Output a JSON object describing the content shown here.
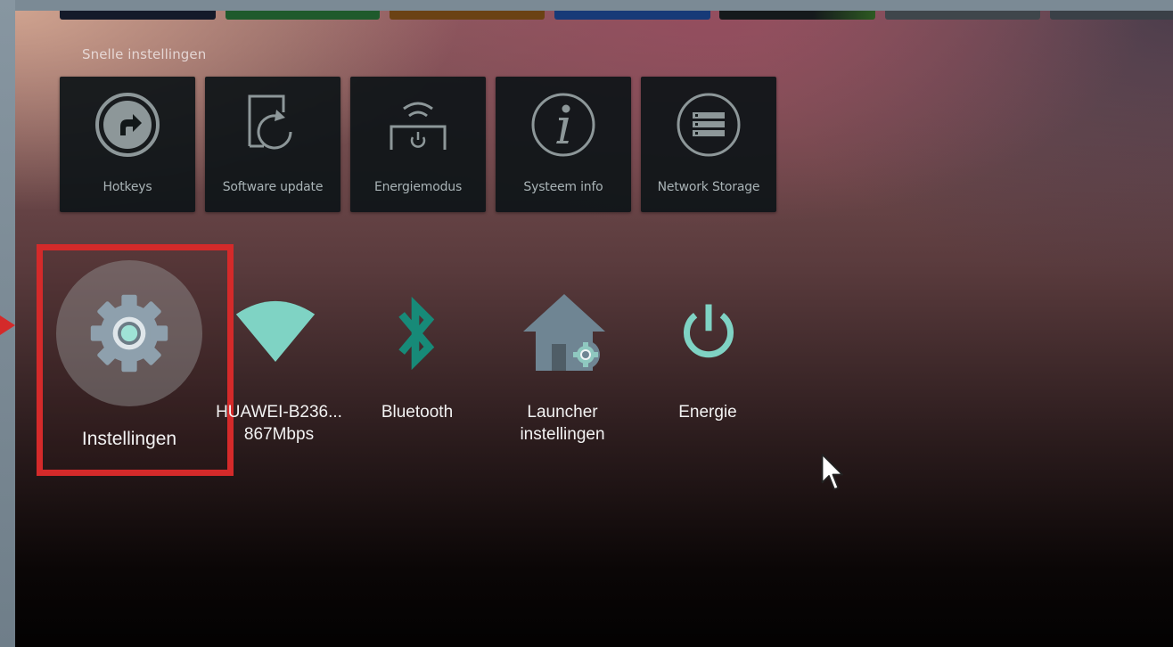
{
  "quick_settings": {
    "title": "Snelle instellingen",
    "tiles": [
      {
        "label": "Hotkeys",
        "icon": "hotkeys-icon"
      },
      {
        "label": "Software update",
        "icon": "software-update-icon"
      },
      {
        "label": "Energiemodus",
        "icon": "energy-mode-icon"
      },
      {
        "label": "Systeem info",
        "icon": "system-info-icon"
      },
      {
        "label": "Network Storage",
        "icon": "network-storage-icon"
      }
    ]
  },
  "apps": {
    "settings": {
      "label": "Instellingen",
      "icon": "gear-icon"
    },
    "wifi": {
      "label_line1": "HUAWEI-B236...",
      "label_line2": "867Mbps",
      "icon": "wifi-icon"
    },
    "bluetooth": {
      "label": "Bluetooth",
      "icon": "bluetooth-icon"
    },
    "launcher": {
      "label_line1": "Launcher",
      "label_line2": "instellingen",
      "icon": "home-settings-icon"
    },
    "energy": {
      "label": "Energie",
      "icon": "power-icon"
    }
  },
  "top_tile_colors": [
    "#141a2a",
    "#1f5a2c",
    "#6b4214",
    "#173a78",
    "#1a1e22",
    "#3f464b",
    "#3a4047"
  ],
  "colors": {
    "accent": "#7fd3c4",
    "highlight": "#d42a2a",
    "tile_bg": "#0e1418"
  }
}
